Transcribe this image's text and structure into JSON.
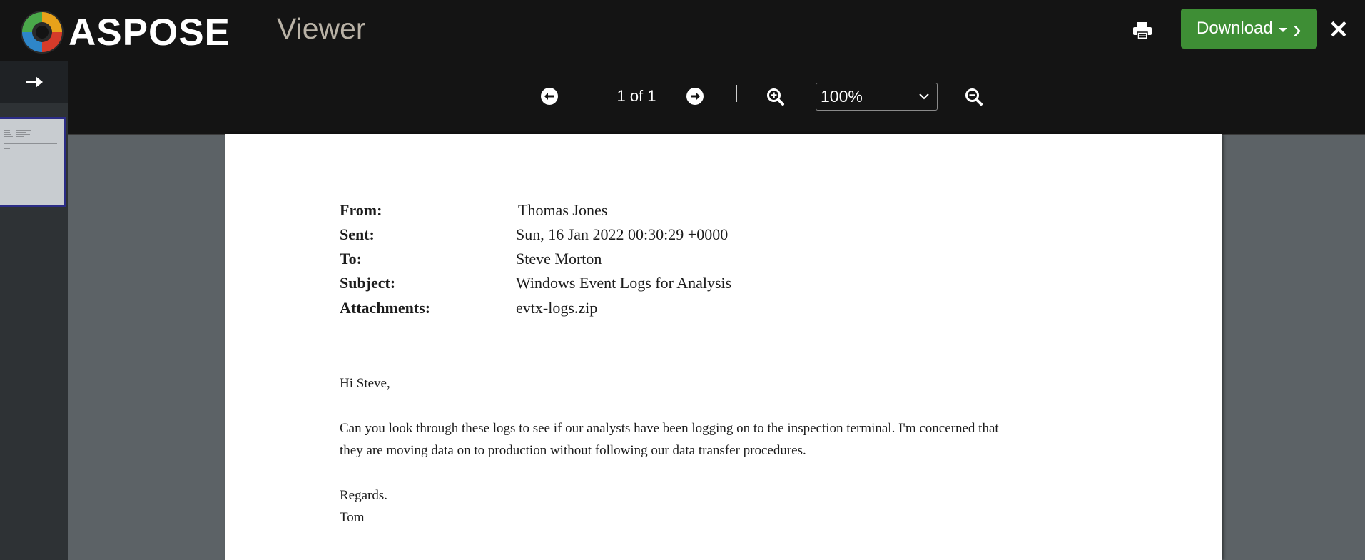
{
  "header": {
    "logo_text": "ASPOSE",
    "app_title": "Viewer",
    "download_label": "Download",
    "print_icon": "print-icon",
    "close_icon": "close-icon"
  },
  "sidebar": {
    "toggle_icon": "arrow-right-icon"
  },
  "toolbar": {
    "page_indicator": "1 of 1",
    "zoom_value": "100%"
  },
  "document": {
    "headers": [
      {
        "label": "From:",
        "value": "Thomas Jones"
      },
      {
        "label": "Sent:",
        "value": "Sun, 16 Jan 2022 00:30:29 +0000"
      },
      {
        "label": "To:",
        "value": "Steve Morton"
      },
      {
        "label": "Subject:",
        "value": "Windows Event Logs for Analysis"
      },
      {
        "label": "Attachments:",
        "value": "evtx-logs.zip"
      }
    ],
    "greeting": "Hi Steve,",
    "body_line1": "Can you look through these logs to see if our analysts have been logging on to the inspection terminal. I'm concerned that",
    "body_line2": "they are moving data on to production without following our data transfer procedures.",
    "closing": "Regards.",
    "signature": "Tom"
  },
  "colors": {
    "topbar": "#141414",
    "download_green": "#3e8e35",
    "viewer_bg": "#5c6266",
    "sidebar_bg": "#2e3235",
    "thumb_border": "#2b2c86"
  }
}
